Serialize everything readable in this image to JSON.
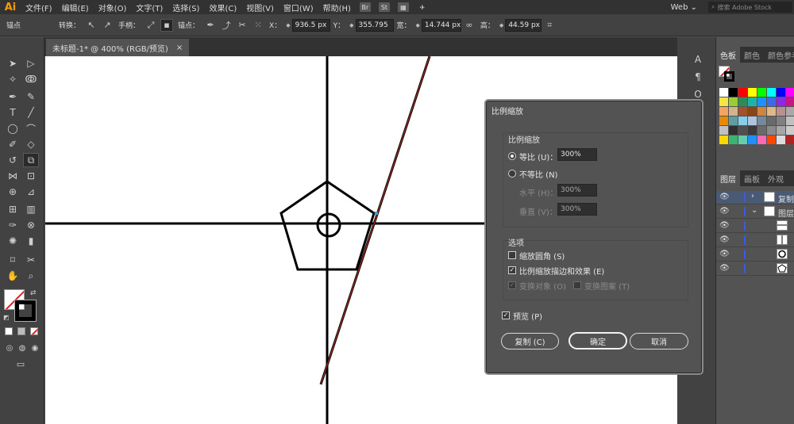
{
  "app": {
    "logo": "Ai"
  },
  "menu": {
    "items": [
      "文件(F)",
      "编辑(E)",
      "对象(O)",
      "文字(T)",
      "选择(S)",
      "效果(C)",
      "视图(V)",
      "窗口(W)",
      "帮助(H)"
    ],
    "badges": [
      "Br",
      "St"
    ],
    "workspace": "Web",
    "search_placeholder": "搜索 Adobe Stock"
  },
  "control_bar": {
    "mode_label": "锚点",
    "convert_label": "转换：",
    "handles_label": "手柄：",
    "anchor_label": "锚点：",
    "x_label": "X：",
    "x_value": "936.5 px",
    "y_label": "Y：",
    "y_value": "355.795",
    "w_label": "宽：",
    "w_value": "14.744 px",
    "h_label": "高：",
    "h_value": "44.59 px"
  },
  "document": {
    "tab_title": "未标题-1* @ 400% (RGB/预览)",
    "close_glyph": "×"
  },
  "panels": {
    "swatches_tabs": [
      "色板",
      "颜色",
      "颜色参考"
    ],
    "layers_tabs": [
      "图层",
      "画板",
      "外观"
    ],
    "layers": [
      {
        "name": "复制"
      },
      {
        "name": "图层"
      },
      {
        "name": ""
      },
      {
        "name": ""
      },
      {
        "name": ""
      },
      {
        "name": ""
      }
    ]
  },
  "dialog": {
    "title": "比例缩放",
    "scale_group_title": "比例缩放",
    "uniform_label": "等比 (U)：",
    "uniform_value": "300%",
    "non_uniform_label": "不等比 (N)",
    "horizontal_label": "水平 (H)：",
    "horizontal_value": "300%",
    "vertical_label": "垂直 (V)：",
    "vertical_value": "300%",
    "options_title": "选项",
    "scale_corners_label": "缩放圆角 (S)",
    "scale_strokes_label": "比例缩放描边和效果 (E)",
    "transform_objects_label": "变换对象 (O)",
    "transform_patterns_label": "变换图案 (T)",
    "preview_label": "预览 (P)",
    "copy_button": "复制 (C)",
    "ok_button": "确定",
    "cancel_button": "取消",
    "state": {
      "uniform_selected": true,
      "scale_corners": false,
      "scale_strokes": true,
      "transform_objects": true,
      "transform_patterns": false,
      "preview": true
    }
  }
}
